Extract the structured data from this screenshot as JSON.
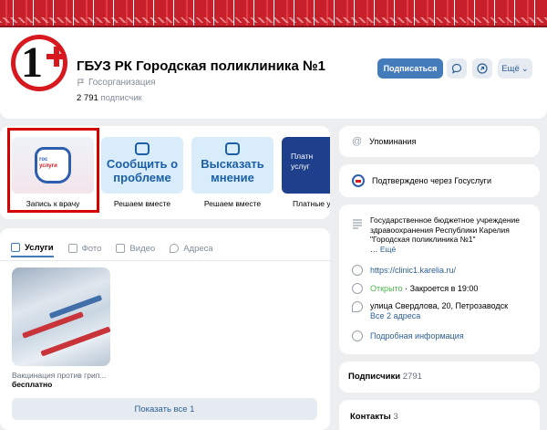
{
  "header": {
    "org_name": "ГБУЗ РК Городская поликлиника №1",
    "org_type": "Госорганизация",
    "subscribers_count": "2 791",
    "subscribers_label": "подписчик",
    "subscribe_label": "Подписаться",
    "more_label": "Ещё",
    "logo_text": "1"
  },
  "apps": [
    {
      "caption": "Запись к врачу",
      "badge_line1": "гос",
      "badge_line2": "услуги"
    },
    {
      "caption": "Решаем вместе",
      "big_text": "Сообщить о проблеме"
    },
    {
      "caption": "Решаем вместе",
      "big_text": "Высказать мнение"
    },
    {
      "caption": "Платные у",
      "big_text": "Платн услуг"
    }
  ],
  "tabs": [
    {
      "label": "Услуги",
      "icon": "services-icon"
    },
    {
      "label": "Фото",
      "icon": "photo-icon"
    },
    {
      "label": "Видео",
      "icon": "video-icon"
    },
    {
      "label": "Адреса",
      "icon": "location-icon"
    }
  ],
  "service": {
    "name": "Вакцинация против грип...",
    "price": "бесплатно",
    "show_all": "Показать все 1"
  },
  "right": {
    "mentions": "Упоминания",
    "verified": "Подтверждено через Госуслуги",
    "description_line1": "Государственное бюджетное учреждение",
    "description_line2": "здравоохранения Республики Карелия",
    "description_line3": "\"Городская поликлиника №1\"",
    "description_more": "Ещё",
    "website": "https://clinic1.karelia.ru/",
    "status_open": "Открыто",
    "status_close": "· Закроется в 19:00",
    "address": "улица Свердлова, 20, Петрозаводск",
    "all_addresses": "Все 2 адреса",
    "details": "Подробная информация",
    "subscribers_label": "Подписчики",
    "subscribers_count": "2791",
    "contacts_label": "Контакты",
    "contacts_count": "3"
  },
  "colors": {
    "accent": "#447bba",
    "cover_red": "#c7202a",
    "link": "#2d5f94",
    "open_green": "#4bb34b"
  }
}
